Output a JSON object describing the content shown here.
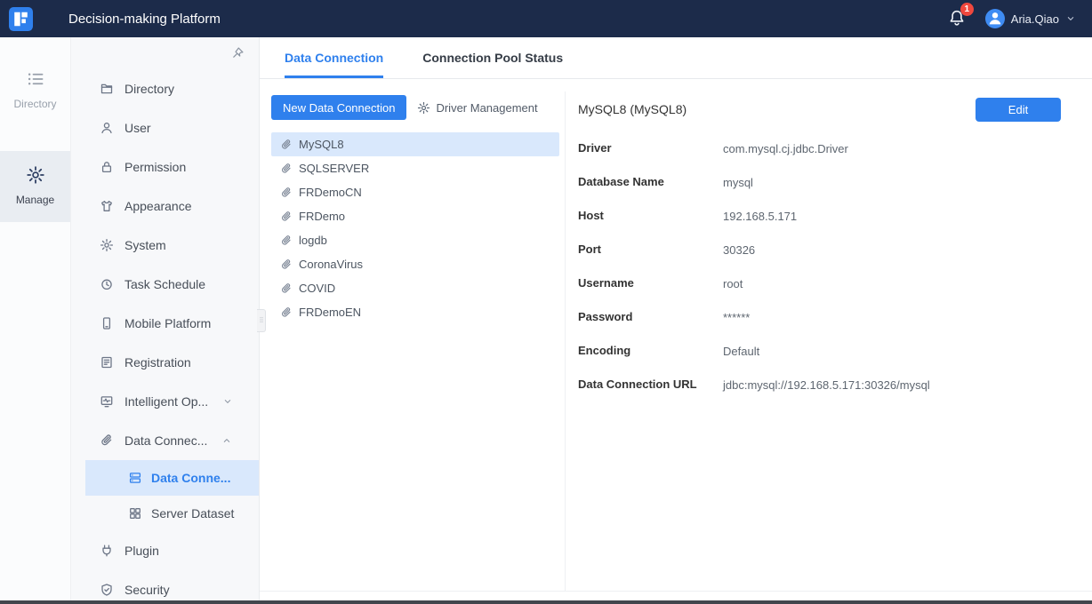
{
  "colors": {
    "accent": "#2f80ed",
    "header_bg": "#1c2b4a",
    "selection_bg": "#d9e8fc",
    "badge": "#f0483e"
  },
  "header": {
    "title": "Decision-making Platform",
    "notification_count": "1",
    "user_name": "Aria.Qiao"
  },
  "rail": {
    "items": [
      {
        "label": "Directory",
        "icon": "rail-directory",
        "active": false
      },
      {
        "label": "Manage",
        "icon": "gear",
        "active": true
      }
    ]
  },
  "sidebar": {
    "items": [
      {
        "label": "Directory",
        "icon": "directory"
      },
      {
        "label": "User",
        "icon": "user"
      },
      {
        "label": "Permission",
        "icon": "lock"
      },
      {
        "label": "Appearance",
        "icon": "shirt"
      },
      {
        "label": "System",
        "icon": "gear"
      },
      {
        "label": "Task Schedule",
        "icon": "clock"
      },
      {
        "label": "Mobile Platform",
        "icon": "mobile"
      },
      {
        "label": "Registration",
        "icon": "registration"
      },
      {
        "label": "Intelligent Op...",
        "icon": "monitor-pulse",
        "chevron": "down"
      },
      {
        "label": "Data Connec...",
        "icon": "paperclip",
        "chevron": "up"
      },
      {
        "label": "Data Conne...",
        "icon": "datasource",
        "child": true,
        "active": true
      },
      {
        "label": "Server Dataset",
        "icon": "dataset",
        "child": true
      },
      {
        "label": "Plugin",
        "icon": "plug"
      },
      {
        "label": "Security",
        "icon": "shield"
      }
    ]
  },
  "tabs": [
    {
      "label": "Data Connection",
      "active": true
    },
    {
      "label": "Connection Pool Status",
      "active": false
    }
  ],
  "connection_list": {
    "new_button": "New Data Connection",
    "driver_management": "Driver Management",
    "selected": "MySQL8",
    "items": [
      "MySQL8",
      "SQLSERVER",
      "FRDemoCN",
      "FRDemo",
      "logdb",
      "CoronaVirus",
      "COVID",
      "FRDemoEN"
    ]
  },
  "detail": {
    "title": "MySQL8 (MySQL8)",
    "edit_button": "Edit",
    "fields": [
      {
        "label": "Driver",
        "value": "com.mysql.cj.jdbc.Driver"
      },
      {
        "label": "Database Name",
        "value": "mysql"
      },
      {
        "label": "Host",
        "value": "192.168.5.171"
      },
      {
        "label": "Port",
        "value": "30326"
      },
      {
        "label": "Username",
        "value": "root"
      },
      {
        "label": "Password",
        "value": "******"
      },
      {
        "label": "Encoding",
        "value": "Default"
      },
      {
        "label": "Data Connection URL",
        "value": "jdbc:mysql://192.168.5.171:30326/mysql"
      }
    ]
  }
}
